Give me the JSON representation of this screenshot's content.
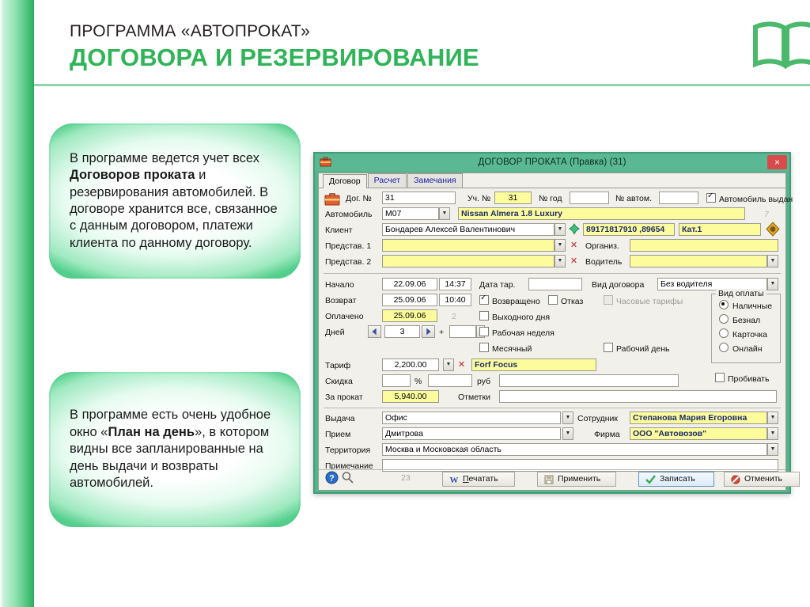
{
  "header": {
    "subtitle": "ПРОГРАММА «АВТОПРОКАТ»",
    "title": "ДОГОВОРА И РЕЗЕРВИРОВАНИЕ",
    "icon": "open-book-icon",
    "accent_color": "#2fb457",
    "rule_color": "#8fd6ab"
  },
  "callouts": [
    {
      "id": "bubble-1",
      "html": "В программе ведется учет всех <b>Договоров проката</b> и резервирования автомобилей. В договоре хранится все, связанное с данным договором, платежи клиента по данному договору."
    },
    {
      "id": "bubble-2",
      "html": "В программе есть очень удобное окно «<b>План на день</b>», в котором видны все запланированные на день выдачи и возвраты автомобилей."
    }
  ],
  "window": {
    "title": "ДОГОВОР ПРОКАТА (Правка)  (31)",
    "titlebar_color": "#5bb894",
    "frame_color": "#54b58c",
    "close_label": "×",
    "app_icon": "briefcase-icon",
    "tabs": [
      {
        "label": "Договор",
        "active": true
      },
      {
        "label": "Расчет",
        "active": false
      },
      {
        "label": "Замечания",
        "active": false
      }
    ],
    "form": {
      "row_contract": {
        "dog_label": "Дог. №",
        "dog_value": "31",
        "uch_label": "Уч. №",
        "uch_value": "31",
        "nomer_god_label": "№ год",
        "nomer_god_value": "",
        "nomer_avtom_label": "№ автом.",
        "nomer_avtom_value": "",
        "issued_label": "Автомобиль выдан",
        "issued_checked": true
      },
      "row_car": {
        "label": "Автомобиль",
        "code_value": "M07",
        "name_value": "Nissan Almera 1.8 Luxury",
        "marker": "7"
      },
      "row_client": {
        "label": "Клиент",
        "name_value": "Бондарев Алексей Валентинович",
        "phone_value": "89171817910 ,89654",
        "category_value": "Кат.1",
        "add_icon": "green-cross-icon",
        "gold_icon": "gold-diamond-icon"
      },
      "row_rep1": {
        "label": "Представ. 1",
        "value": "",
        "org_label": "Организ.",
        "org_value": ""
      },
      "row_rep2": {
        "label": "Представ. 2",
        "value": "",
        "driver_label": "Водитель",
        "driver_value": ""
      },
      "row_start": {
        "label": "Начало",
        "date": "22.09.06",
        "time": "14:37",
        "tar_label": "Дата тар.",
        "tar_value": "",
        "contract_type_label": "Вид договора",
        "contract_type_value": "Без водителя"
      },
      "row_return": {
        "label": "Возврат",
        "date": "25.09.06",
        "time": "10:40",
        "returned_label": "Возвращено",
        "returned_checked": true,
        "refusal_label": "Отказ",
        "refusal_checked": false,
        "hourly_label": "Часовые тарифы",
        "hourly_checked": false,
        "hourly_disabled": true
      },
      "row_paid": {
        "label": "Оплачено",
        "date": "25.09.06",
        "counter": "2",
        "weekend_label": "Выходного дня",
        "weekend_checked": false
      },
      "row_days": {
        "label": "Дней",
        "value": "3",
        "plus": "+",
        "extra": "",
        "workweek_label": "Рабочая неделя",
        "workweek_checked": false
      },
      "row_monthly": {
        "monthly_label": "Месячный",
        "monthly_checked": false,
        "workday_label": "Рабочий день",
        "workday_checked": false
      },
      "payment_group": {
        "title": "Вид оплаты",
        "options": [
          {
            "label": "Наличные",
            "selected": true
          },
          {
            "label": "Безнал",
            "selected": false
          },
          {
            "label": "Карточка",
            "selected": false
          },
          {
            "label": "Онлайн",
            "selected": false
          }
        ],
        "punch_label": "Пробивать",
        "punch_checked": false
      },
      "row_tariff": {
        "label": "Тариф",
        "value": "2,200.00",
        "name": "Forf Focus"
      },
      "row_discount": {
        "label": "Скидка",
        "percent": "",
        "percent_sign": "%",
        "rub_value": "",
        "rub_label": "руб",
        "note": ""
      },
      "row_total": {
        "label": "За прокат",
        "value": "5,940.00",
        "marks_label": "Отметки",
        "marks_value": ""
      },
      "row_issue": {
        "label": "Выдача",
        "value": "Офис",
        "employee_label": "Сотрудник",
        "employee_value": "Степанова Мария Егоровна"
      },
      "row_accept": {
        "label": "Прием",
        "value": "Дмитрова",
        "firm_label": "Фирма",
        "firm_value": "ООО \"Автовозов\""
      },
      "row_territory": {
        "label": "Территория",
        "value": "Москва и Московская область"
      },
      "row_note": {
        "label": "Примечание",
        "value": ""
      }
    },
    "buttons": {
      "help_icon": "help-question-icon",
      "hint_icon": "magnifier-icon",
      "page_number": "23",
      "print_label": "Печатать",
      "print_accel": "П",
      "print_icon": "word-doc-icon",
      "apply_label": "Применить",
      "apply_icon": "floppy-save-icon",
      "save_label": "Записать",
      "save_icon": "green-check-icon",
      "cancel_label": "Отменить",
      "cancel_icon": "red-cancel-icon"
    }
  }
}
